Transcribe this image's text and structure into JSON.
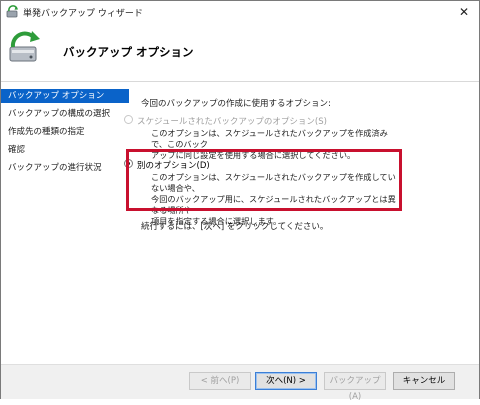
{
  "window": {
    "title": "単発バックアップ ウィザード",
    "close_glyph": "✕"
  },
  "header": {
    "title": "バックアップ オプション",
    "icon": "backup-wizard-icon"
  },
  "sidebar": {
    "items": [
      {
        "label": "バックアップ オプション",
        "active": true
      },
      {
        "label": "バックアップの構成の選択",
        "active": false
      },
      {
        "label": "作成先の種類の指定",
        "active": false
      },
      {
        "label": "確認",
        "active": false
      },
      {
        "label": "バックアップの進行状況",
        "active": false
      }
    ]
  },
  "main": {
    "intro": "今回のバックアップの作成に使用するオプション:",
    "option_scheduled": {
      "label": "スケジュールされたバックアップのオプション(S)",
      "desc_line1": "このオプションは、スケジュールされたバックアップを作成済みで、このバック",
      "desc_line2": "アップに同じ設定を使用する場合に選択してください。",
      "enabled": false,
      "selected": false
    },
    "option_other": {
      "label": "別のオプション(D)",
      "desc_line1": "このオプションは、スケジュールされたバックアップを作成していない場合や、",
      "desc_line2": "今回のバックアップ用に、スケジュールされたバックアップとは異なる場所や",
      "desc_line3": "項目を指定する場合に選択します。",
      "enabled": true,
      "selected": true
    },
    "continue_text": "続行するには、[次へ] をクリックしてください。"
  },
  "footer": {
    "back_label": "< 前へ(P)",
    "next_label": "次へ(N) >",
    "backup_label": "バックアップ(A)",
    "cancel_label": "キャンセル"
  },
  "colors": {
    "accent": "#0a63c9",
    "highlight": "#c8102e"
  }
}
